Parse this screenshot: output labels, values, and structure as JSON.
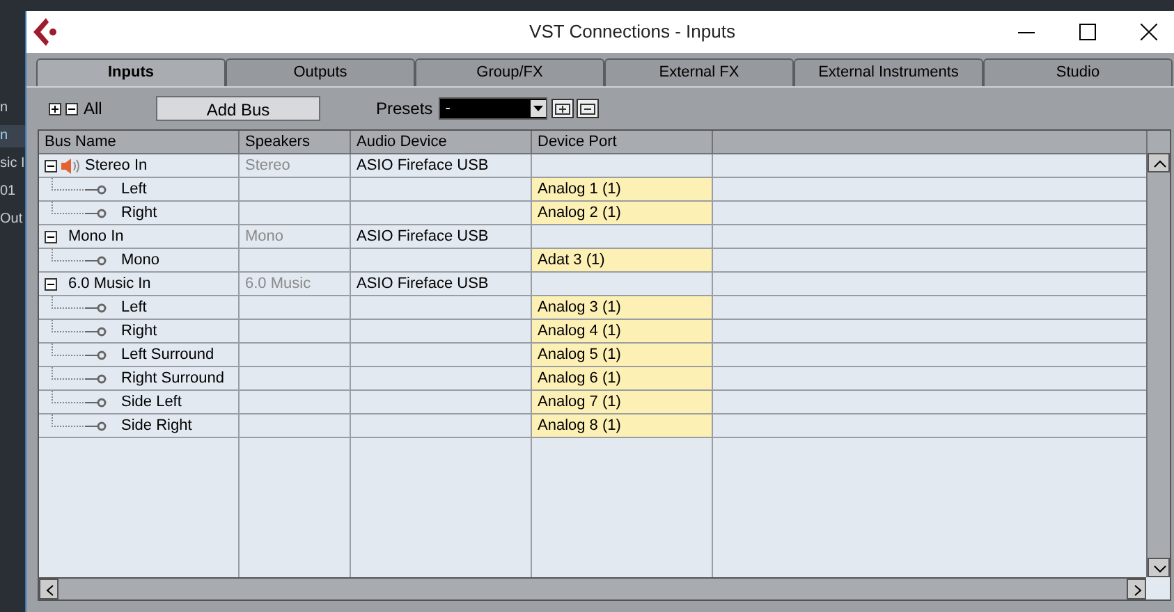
{
  "background_items": [
    {
      "text": "n",
      "selected": false
    },
    {
      "text": "n",
      "selected": true
    },
    {
      "text": "sic I",
      "selected": false
    },
    {
      "text": "01",
      "selected": false
    },
    {
      "text": "Out",
      "selected": false
    }
  ],
  "window": {
    "title": "VST Connections - Inputs"
  },
  "tabs": [
    {
      "label": "Inputs",
      "selected": true
    },
    {
      "label": "Outputs",
      "selected": false
    },
    {
      "label": "Group/FX",
      "selected": false
    },
    {
      "label": "External FX",
      "selected": false
    },
    {
      "label": "External Instruments",
      "selected": false
    },
    {
      "label": "Studio",
      "selected": false
    }
  ],
  "toolbar": {
    "all_label": "All",
    "add_bus": "Add Bus",
    "presets_label": "Presets",
    "presets_value": "-"
  },
  "table": {
    "columns": [
      "Bus Name",
      "Speakers",
      "Audio Device",
      "Device Port"
    ],
    "buses": [
      {
        "name": "Stereo In",
        "speakers": "Stereo",
        "device": "ASIO Fireface USB",
        "expanded": true,
        "monitored": true,
        "children": [
          {
            "name": "Left",
            "port": "Analog 1 (1)"
          },
          {
            "name": "Right",
            "port": "Analog 2 (1)"
          }
        ]
      },
      {
        "name": "Mono In",
        "speakers": "Mono",
        "device": "ASIO Fireface USB",
        "expanded": true,
        "monitored": false,
        "children": [
          {
            "name": "Mono",
            "port": "Adat 3 (1)"
          }
        ]
      },
      {
        "name": "6.0 Music In",
        "speakers": "6.0 Music",
        "device": "ASIO Fireface USB",
        "expanded": true,
        "monitored": false,
        "children": [
          {
            "name": "Left",
            "port": "Analog 3 (1)"
          },
          {
            "name": "Right",
            "port": "Analog 4 (1)"
          },
          {
            "name": "Left Surround",
            "port": "Analog 5 (1)"
          },
          {
            "name": "Right Surround",
            "port": "Analog 6 (1)"
          },
          {
            "name": "Side Left",
            "port": "Analog 7 (1)"
          },
          {
            "name": "Side Right",
            "port": "Analog 8 (1)"
          }
        ]
      }
    ]
  }
}
